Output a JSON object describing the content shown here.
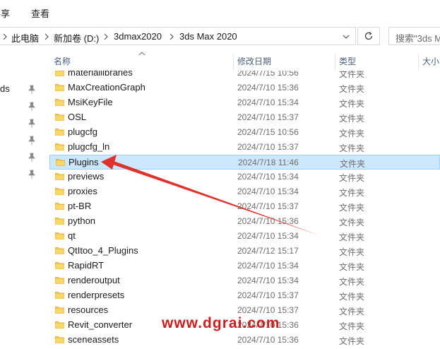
{
  "ribbon": {
    "tab_share": "共享",
    "tab_view": "查看"
  },
  "address": {
    "crumbs": [
      "此电脑",
      "新加卷 (D:)",
      "3dmax2020",
      "3ds Max 2020"
    ],
    "search_placeholder": "搜索\"3ds M"
  },
  "nav": {
    "label": "ds"
  },
  "columns": {
    "name": "名称",
    "date": "修改日期",
    "type": "类型",
    "size": "大小"
  },
  "files": [
    {
      "name": "materiallibraries",
      "date": "2024/7/15 10:56",
      "type": "文件夹"
    },
    {
      "name": "MaxCreationGraph",
      "date": "2024/7/10 15:36",
      "type": "文件夹"
    },
    {
      "name": "MsiKeyFile",
      "date": "2024/7/10 15:34",
      "type": "文件夹"
    },
    {
      "name": "OSL",
      "date": "2024/7/10 15:37",
      "type": "文件夹"
    },
    {
      "name": "plugcfg",
      "date": "2024/7/15 10:56",
      "type": "文件夹"
    },
    {
      "name": "plugcfg_ln",
      "date": "2024/7/10 15:37",
      "type": "文件夹"
    },
    {
      "name": "Plugins",
      "date": "2024/7/18 11:46",
      "type": "文件夹",
      "selected": true
    },
    {
      "name": "previews",
      "date": "2024/7/10 15:34",
      "type": "文件夹"
    },
    {
      "name": "proxies",
      "date": "2024/7/10 15:34",
      "type": "文件夹"
    },
    {
      "name": "pt-BR",
      "date": "2024/7/10 15:37",
      "type": "文件夹"
    },
    {
      "name": "python",
      "date": "2024/7/10 15:36",
      "type": "文件夹"
    },
    {
      "name": "qt",
      "date": "2024/7/10 15:34",
      "type": "文件夹"
    },
    {
      "name": "QtItoo_4_Plugins",
      "date": "2024/7/12 15:17",
      "type": "文件夹"
    },
    {
      "name": "RapidRT",
      "date": "2024/7/10 15:34",
      "type": "文件夹"
    },
    {
      "name": "renderoutput",
      "date": "2024/7/10 15:34",
      "type": "文件夹"
    },
    {
      "name": "renderpresets",
      "date": "2024/7/10 15:37",
      "type": "文件夹"
    },
    {
      "name": "resources",
      "date": "2024/7/10 15:37",
      "type": "文件夹"
    },
    {
      "name": "Revit_converter",
      "date": "2024/7/10 15:36",
      "type": "文件夹"
    },
    {
      "name": "sceneassets",
      "date": "2024/7/10 15:36",
      "type": "文件夹"
    }
  ],
  "watermark": "www.dgrai.com",
  "colors": {
    "selection": "#cce8ff",
    "folder": "#f7c94b",
    "arrow": "#e0312c"
  }
}
